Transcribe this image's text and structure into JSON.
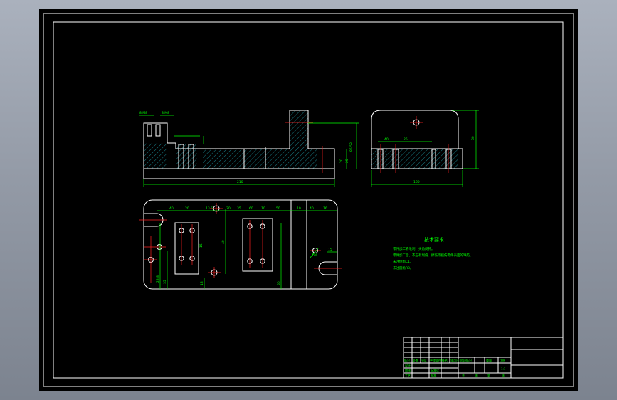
{
  "drawing": {
    "background_color": "#000000",
    "line_color": "#ffffff",
    "dimension_color": "#00ff00",
    "center_line_color": "#ff2020",
    "hatch_color": "#29d6e8",
    "front_view": {
      "dims_top": [
        "8 M8",
        "8 M8"
      ],
      "overall_length": "210",
      "height_right": "85.58",
      "dim_right_small": "20",
      "dim_right_small2": "25"
    },
    "side_view": {
      "width": "160",
      "height": "80",
      "dim_a": "40",
      "dim_b": "25"
    },
    "plan_view": {
      "dims_top": [
        "40",
        "20",
        "13.5",
        "20",
        "35",
        "60",
        "10",
        "50",
        "10",
        "40",
        "16"
      ],
      "dims_left": [
        "28.8",
        "35"
      ],
      "dims_bottom": [
        "18",
        "40",
        "15",
        "50"
      ],
      "dims_right": [
        "R3",
        "15"
      ]
    },
    "technical_requirements": {
      "title": "技术要求",
      "items": [
        "零件加工去毛刺，尖角倒钝。",
        "零件加工后，不应有划痕、擦伤等损伤零件表面的缺陷。",
        "未注倒角C1。",
        "未注圆角R3。"
      ]
    },
    "title_block": {
      "col_headers": [
        "标记",
        "处数",
        "分区",
        "更改文件号",
        "签名",
        "年月日"
      ],
      "row_labels": [
        "设计",
        "审核",
        "工艺",
        "标准化",
        "批准"
      ],
      "mid_labels": [
        "阶段标记",
        "重量",
        "比例"
      ],
      "scale": "1:1",
      "sheet": [
        "共",
        "张",
        "第",
        "张"
      ]
    }
  }
}
